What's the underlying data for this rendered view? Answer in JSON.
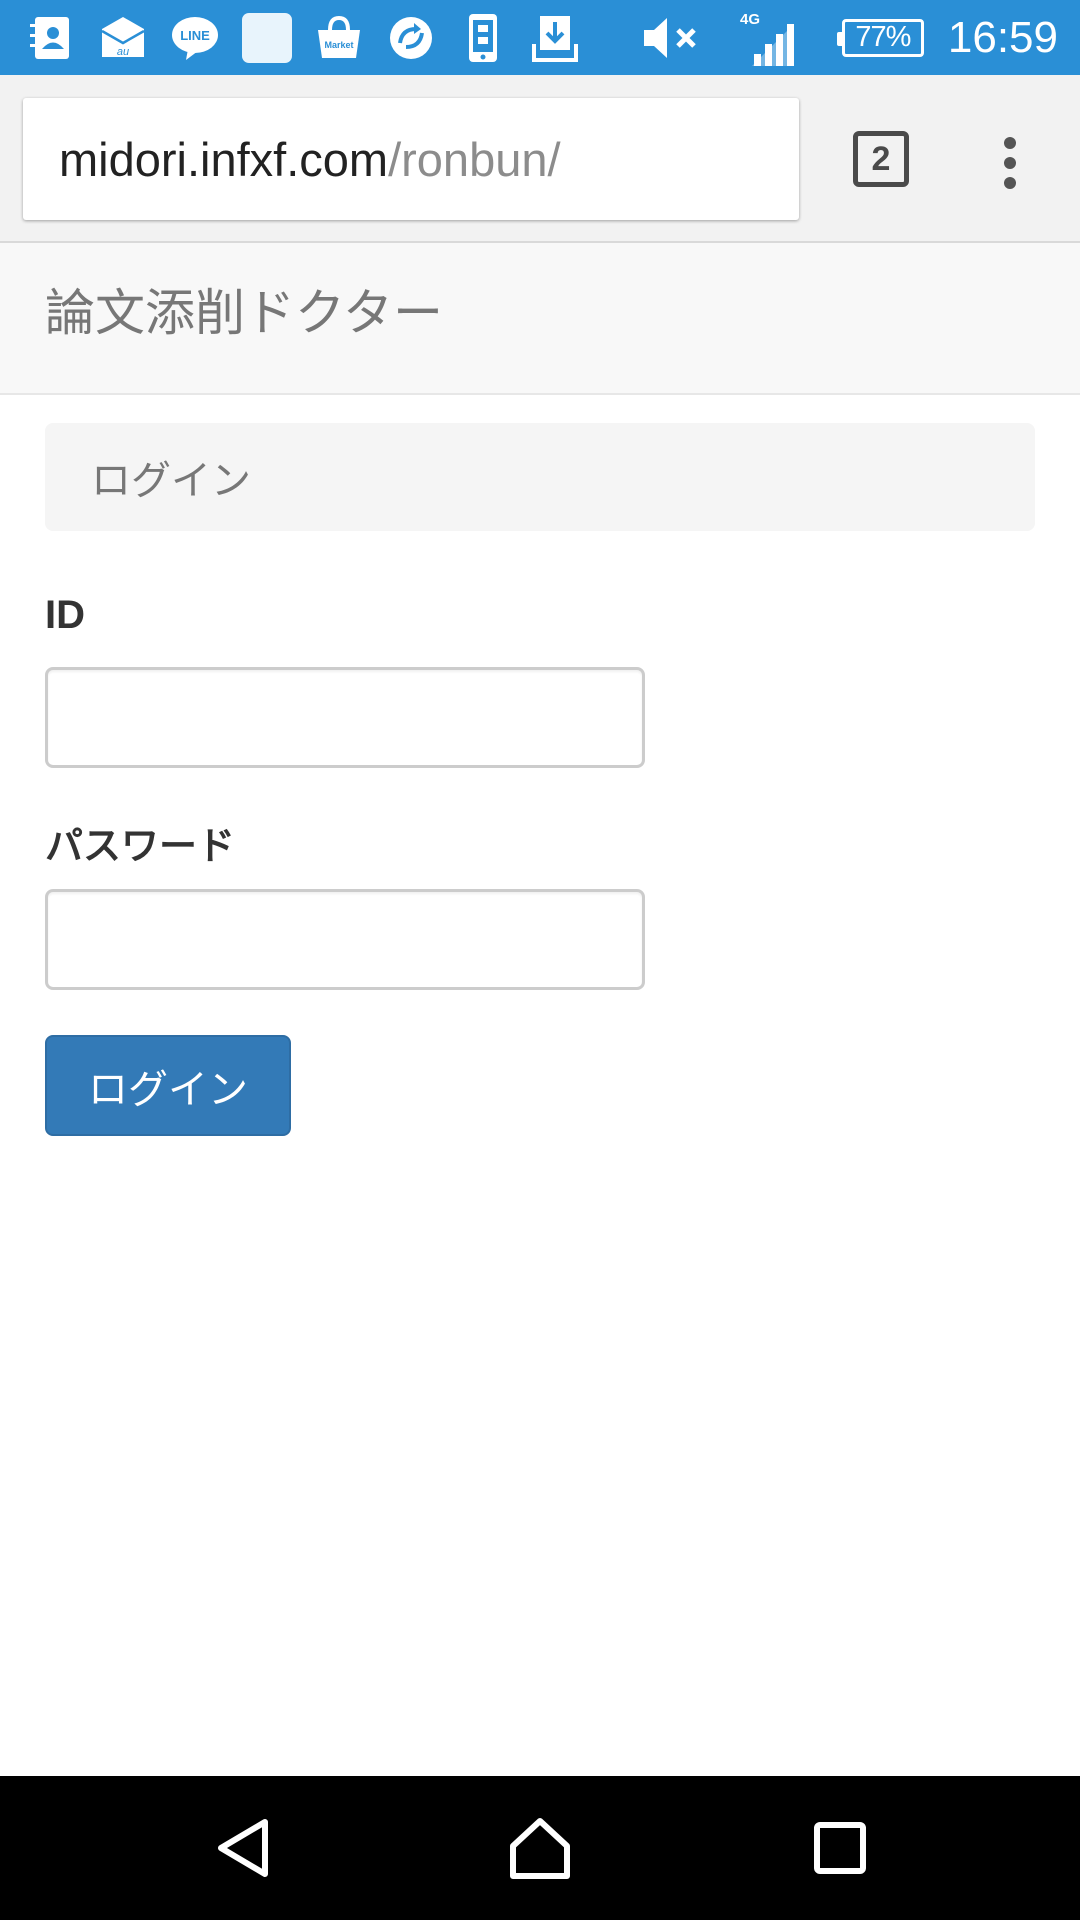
{
  "status_bar": {
    "notification_icons": [
      {
        "icon": "contacts-icon"
      },
      {
        "icon": "au-mail-icon",
        "text": "au"
      },
      {
        "icon": "line-icon",
        "text": "LINE"
      },
      {
        "icon": "blank-app-icon"
      },
      {
        "icon": "market-icon",
        "text": "Market"
      },
      {
        "icon": "sync-icon"
      },
      {
        "icon": "phone-transfer-icon"
      },
      {
        "icon": "download-icon"
      }
    ],
    "mute_icon": "volume-mute-icon",
    "network_type": "4G",
    "battery_percent": "77%",
    "time": "16:59",
    "background_color": "#2a8fd6"
  },
  "browser": {
    "url_domain": "midori.infxf.com",
    "url_path": "/ronbun/",
    "tab_count": "2"
  },
  "page": {
    "brand_title": "論文添削ドクター",
    "panel_heading": "ログイン",
    "id_label": "ID",
    "password_label": "パスワード",
    "id_value": "",
    "password_value": "",
    "login_button_label": "ログイン",
    "accent_color": "#337ab7"
  },
  "nav_bar": {
    "buttons": [
      "back-icon",
      "home-icon",
      "recents-icon"
    ]
  }
}
